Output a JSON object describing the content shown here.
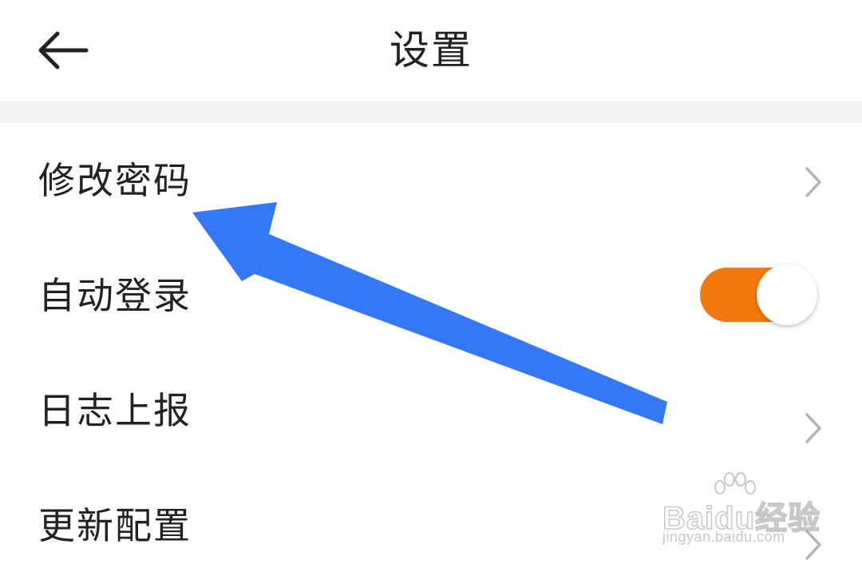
{
  "header": {
    "title": "设置",
    "back_icon": "arrow-left-icon"
  },
  "settings": {
    "items": [
      {
        "label": "修改密码",
        "control": "chevron"
      },
      {
        "label": "自动登录",
        "control": "toggle",
        "toggle_on": true
      },
      {
        "label": "日志上报",
        "control": "chevron"
      },
      {
        "label": "更新配置",
        "control": "chevron"
      }
    ]
  },
  "annotation": {
    "type": "arrow",
    "color": "#3478f6",
    "points_to": "修改密码"
  },
  "watermark": {
    "brand": "Baidu经验",
    "url": "jingyan.baidu.com"
  },
  "colors": {
    "toggle_on": "#f5780a",
    "divider_band": "#f2f3f5",
    "chevron": "#b5b5b5",
    "text": "#222222"
  }
}
